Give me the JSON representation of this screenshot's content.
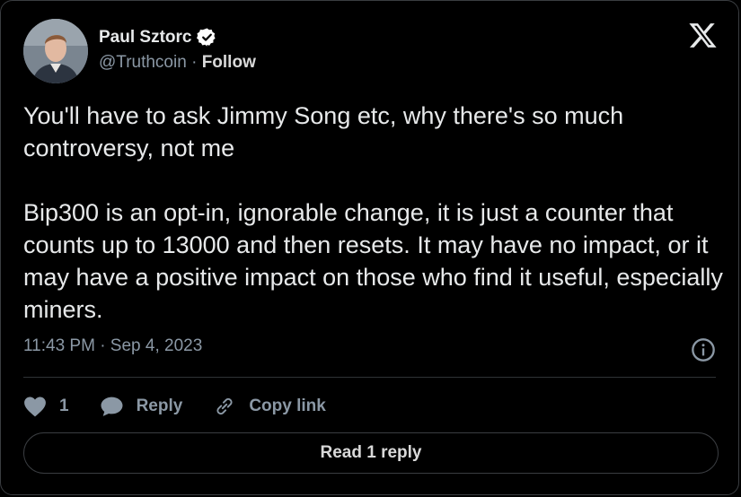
{
  "author": {
    "name": "Paul Sztorc",
    "handle": "@Truthcoin",
    "separator": "·",
    "follow_label": "Follow"
  },
  "tweet": {
    "paragraphs": [
      "You'll have to ask Jimmy Song etc, why there's so much controversy, not me",
      "Bip300 is an opt-in, ignorable change, it is just a counter that counts up to 13000 and then resets. It may have no impact, or it may have a positive impact on those who find it useful, especially miners."
    ],
    "timestamp": "11:43 PM · Sep 4, 2023"
  },
  "actions": {
    "like_count": "1",
    "reply_label": "Reply",
    "copy_label": "Copy link"
  },
  "read_replies_label": "Read 1 reply",
  "icons": [
    "verified-badge-icon",
    "x-logo-icon",
    "info-icon",
    "heart-icon",
    "reply-bubble-icon",
    "link-icon"
  ],
  "colors": {
    "background": "#000000",
    "text": "#e7e9ea",
    "muted": "#8b98a5",
    "border": "#3a3d41"
  }
}
